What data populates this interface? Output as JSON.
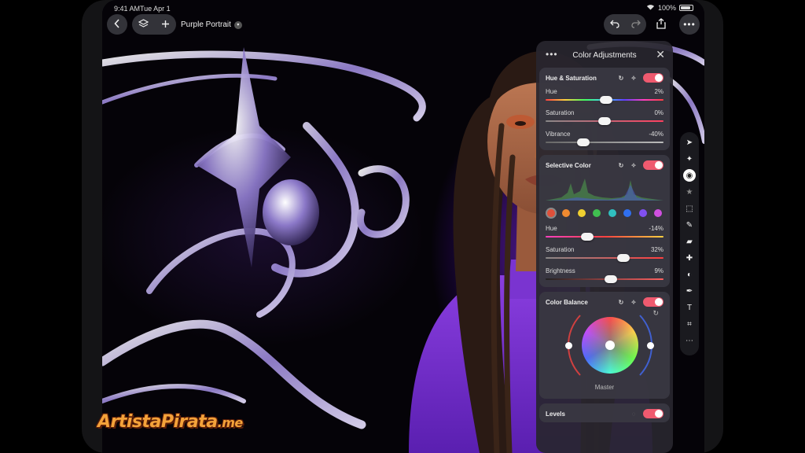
{
  "status": {
    "time": "9:41 AM",
    "date": "Tue Apr 1",
    "battery": "100%"
  },
  "toolbar": {
    "document_title": "Purple Portrait"
  },
  "panel": {
    "title": "Color Adjustments",
    "hue_saturation": {
      "title": "Hue & Saturation",
      "enabled": true,
      "sliders": [
        {
          "label": "Hue",
          "value": "2%"
        },
        {
          "label": "Saturation",
          "value": "0%"
        },
        {
          "label": "Vibrance",
          "value": "-40%"
        }
      ]
    },
    "selective_color": {
      "title": "Selective Color",
      "enabled": true,
      "swatches": [
        "#e0503a",
        "#f08a30",
        "#f0d030",
        "#40c050",
        "#30c0c0",
        "#3070f0",
        "#8050f0",
        "#d050e0"
      ],
      "selected_swatch": 0,
      "sliders": [
        {
          "label": "Hue",
          "value": "-14%"
        },
        {
          "label": "Saturation",
          "value": "32%"
        },
        {
          "label": "Brightness",
          "value": "9%"
        }
      ]
    },
    "color_balance": {
      "title": "Color Balance",
      "enabled": true,
      "mode": "Master"
    },
    "levels": {
      "title": "Levels",
      "enabled": true
    }
  },
  "watermark": {
    "text": "ArtistaPirata",
    "suffix": ".me"
  },
  "colors": {
    "accent_toggle": "#ef5a6f",
    "panel_bg": "#2a2830",
    "glow": "#8a2cff"
  }
}
